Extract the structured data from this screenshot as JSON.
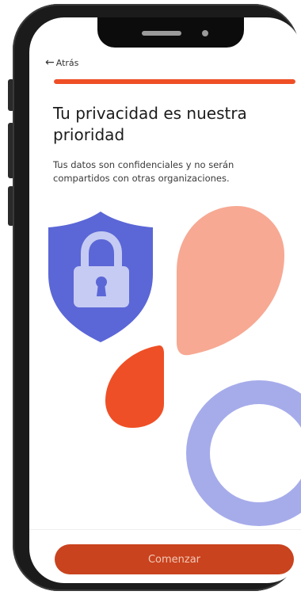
{
  "nav": {
    "back_label": "Atrás",
    "back_icon": "arrow-left-icon"
  },
  "progress": {
    "value_fraction": 1.0
  },
  "content": {
    "title": "Tu privacidad es nuestra prioridad",
    "subtitle": "Tus datos son confidenciales y no serán compartidos con otras organizaciones."
  },
  "illustration": {
    "icons": [
      "shield-icon",
      "lock-icon"
    ],
    "colors": {
      "shield": "#5b67d6",
      "lock": "#c6cbf3",
      "drop_large": "#f7a993",
      "drop_small": "#ef4f26",
      "ring": "#a6acea"
    }
  },
  "footer": {
    "cta_label": "Comenzar"
  },
  "colors": {
    "accent": "#ef4f26",
    "button": "#c9431e",
    "button_text": "#f4c9b8"
  }
}
